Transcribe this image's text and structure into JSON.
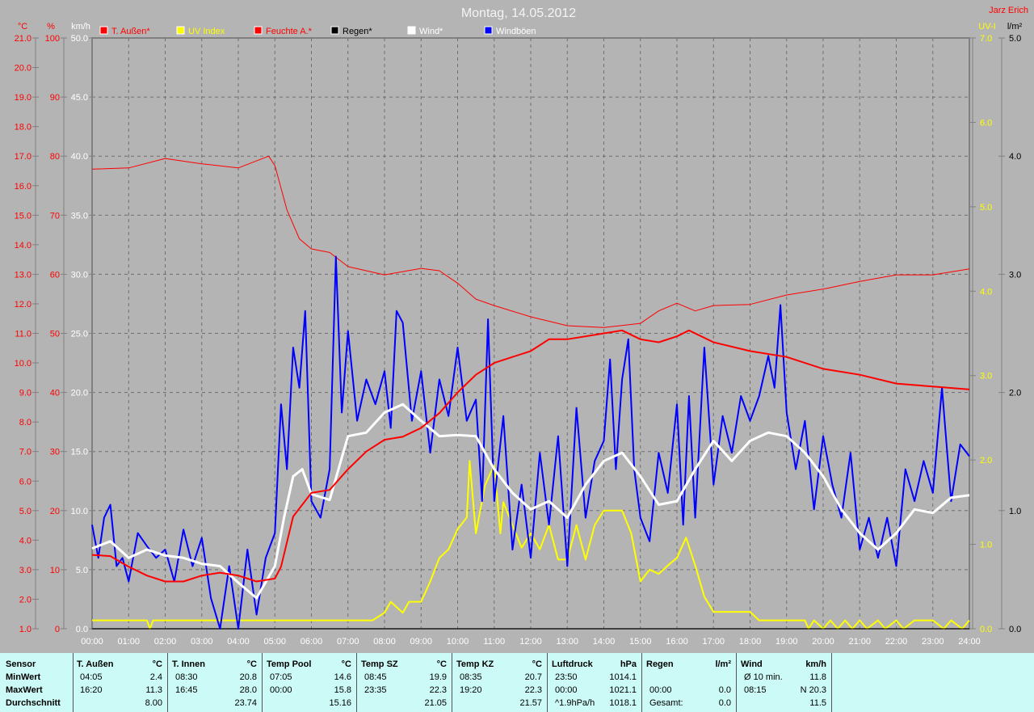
{
  "title": "Montag, 14.05.2012",
  "author": "Jarz Erich",
  "colors": {
    "temp": "#ff0000",
    "hum": "#ff0000",
    "uv": "#ffff00",
    "rain": "#000000",
    "wind": "#ffffff",
    "gust": "#0000ff"
  },
  "chart_data": {
    "type": "line",
    "title": "Montag, 14.05.2012",
    "x_unit": "hours",
    "xlim": [
      0,
      24
    ],
    "x_ticks": [
      "00:00",
      "01:00",
      "02:00",
      "03:00",
      "04:00",
      "05:00",
      "06:00",
      "07:00",
      "08:00",
      "09:00",
      "10:00",
      "11:00",
      "12:00",
      "13:00",
      "14:00",
      "15:00",
      "16:00",
      "17:00",
      "18:00",
      "19:00",
      "20:00",
      "21:00",
      "22:00",
      "23:00",
      "24:00"
    ],
    "axes": [
      {
        "id": "temp",
        "label": "°C",
        "range": [
          1,
          21
        ],
        "step": 1,
        "side": "left",
        "color": "#ff0000",
        "decimals": 1
      },
      {
        "id": "hum",
        "label": "%",
        "range": [
          0,
          100
        ],
        "step": 10,
        "side": "left",
        "color": "#ff0000",
        "decimals": 0
      },
      {
        "id": "kmh",
        "label": "km/h",
        "range": [
          0,
          50
        ],
        "step": 5,
        "side": "left",
        "color": "#ffffff",
        "decimals": 1
      },
      {
        "id": "uv",
        "label": "UV-I",
        "range": [
          0,
          7
        ],
        "step": 1,
        "side": "right",
        "color": "#ffff00",
        "decimals": 1
      },
      {
        "id": "rain",
        "label": "l/m²",
        "range": [
          0,
          5
        ],
        "step": 1,
        "side": "right",
        "color": "#000000",
        "decimals": 1
      }
    ],
    "legend": [
      "T. Außen*",
      "UV Index",
      "Feuchte A.*",
      "Regen*",
      "Wind*",
      "Windböen"
    ],
    "grid": true,
    "series": [
      {
        "name": "Feuchte A.*",
        "axis": "hum",
        "color": "#ff0000",
        "width": 1,
        "x": [
          0,
          1,
          2,
          3,
          4,
          4.83,
          5,
          5.33,
          5.67,
          6,
          6.5,
          7,
          8,
          9,
          9.5,
          10,
          10.5,
          11,
          12,
          13,
          14,
          15,
          15.5,
          16,
          16.5,
          17,
          18,
          19,
          20,
          21,
          22,
          23,
          24
        ],
        "y": [
          77.8,
          78,
          79.6,
          78.7,
          78,
          80,
          78.4,
          70.9,
          66,
          64.3,
          63.7,
          61.3,
          59.9,
          61,
          60.6,
          58.5,
          55.8,
          54.7,
          52.8,
          51.3,
          51,
          51.7,
          53.8,
          55.1,
          53.8,
          54.7,
          54.9,
          56.5,
          57.5,
          58.8,
          59.9,
          59.9,
          60.9
        ]
      },
      {
        "name": "UV Index",
        "axis": "uv",
        "color": "#ffff00",
        "width": 2,
        "x": [
          0,
          1.5,
          1.58,
          1.67,
          7.67,
          8,
          8.17,
          8.5,
          8.67,
          9,
          9.25,
          9.5,
          9.75,
          10,
          10.25,
          10.33,
          10.5,
          10.75,
          11,
          11.17,
          11.25,
          11.5,
          11.75,
          12,
          12.25,
          12.5,
          12.75,
          13,
          13.25,
          13.5,
          13.75,
          14,
          14.5,
          14.75,
          15,
          15.25,
          15.5,
          15.75,
          16,
          16.25,
          16.5,
          16.75,
          17,
          17.5,
          18,
          18.25,
          19.5,
          19.6,
          19.75,
          20,
          20.2,
          20.4,
          20.6,
          20.8,
          21,
          21.2,
          21.5,
          21.7,
          22,
          22.2,
          22.5,
          22.7,
          23,
          23.3,
          23.5,
          23.8,
          24
        ],
        "y": [
          0.1,
          0.1,
          0,
          0.1,
          0.1,
          0.19,
          0.32,
          0.19,
          0.32,
          0.32,
          0.56,
          0.84,
          0.94,
          1.18,
          1.32,
          1.99,
          1.13,
          1.7,
          1.94,
          1.13,
          1.5,
          1.23,
          0.96,
          1.13,
          0.94,
          1.23,
          0.82,
          0.82,
          1.23,
          0.82,
          1.23,
          1.4,
          1.4,
          1.13,
          0.56,
          0.7,
          0.65,
          0.75,
          0.84,
          1.08,
          0.75,
          0.38,
          0.2,
          0.2,
          0.2,
          0.1,
          0.1,
          0,
          0.1,
          0,
          0.1,
          0,
          0.1,
          0,
          0.1,
          0,
          0.1,
          0,
          0.1,
          0,
          0.1,
          0.1,
          0.1,
          0,
          0.1,
          0,
          0.1
        ]
      },
      {
        "name": "Regen*",
        "axis": "rain",
        "color": "#000000",
        "width": 1,
        "x": [
          0,
          24
        ],
        "y": [
          0,
          0
        ]
      },
      {
        "name": "Windböen",
        "axis": "kmh",
        "color": "#0000ff",
        "width": 2,
        "x": [
          0,
          0.17,
          0.33,
          0.5,
          0.67,
          0.83,
          1,
          1.25,
          1.5,
          1.75,
          2,
          2.25,
          2.5,
          2.75,
          3,
          3.25,
          3.5,
          3.75,
          4,
          4.25,
          4.5,
          4.75,
          5,
          5.17,
          5.33,
          5.5,
          5.67,
          5.83,
          6,
          6.25,
          6.5,
          6.67,
          6.83,
          7,
          7.25,
          7.5,
          7.75,
          8,
          8.17,
          8.33,
          8.5,
          8.75,
          9,
          9.25,
          9.5,
          9.75,
          10,
          10.25,
          10.5,
          10.67,
          10.83,
          11,
          11.25,
          11.5,
          11.75,
          12,
          12.25,
          12.5,
          12.75,
          13,
          13.25,
          13.5,
          13.75,
          14,
          14.17,
          14.33,
          14.5,
          14.67,
          14.83,
          15,
          15.25,
          15.5,
          15.75,
          16,
          16.17,
          16.33,
          16.5,
          16.75,
          17,
          17.25,
          17.5,
          17.75,
          18,
          18.25,
          18.5,
          18.67,
          18.83,
          19,
          19.25,
          19.5,
          19.75,
          20,
          20.25,
          20.5,
          20.75,
          21,
          21.25,
          21.5,
          21.75,
          22,
          22.25,
          22.5,
          22.75,
          23,
          23.25,
          23.5,
          23.75,
          24
        ],
        "y": [
          8.8,
          6,
          9.4,
          10.5,
          5.3,
          6,
          4,
          8.1,
          7,
          6,
          6.7,
          4,
          8.4,
          5.3,
          7.7,
          2.6,
          0,
          5.3,
          0,
          6.7,
          1.2,
          6,
          8.1,
          19,
          13.5,
          23.8,
          20.4,
          26.9,
          10.8,
          9.4,
          13.5,
          31.5,
          18.3,
          25.2,
          17.6,
          21.1,
          19,
          21.8,
          17,
          26.9,
          25.9,
          17.6,
          21.8,
          14.9,
          21.1,
          18,
          23.8,
          17.6,
          19.4,
          10.8,
          26.2,
          10.8,
          18,
          6.7,
          12.2,
          6,
          14.9,
          8.8,
          16.3,
          5.3,
          18.7,
          9.4,
          14.2,
          15.9,
          22.8,
          13.5,
          21.1,
          24.5,
          13.5,
          9.4,
          7.4,
          14.9,
          11.5,
          19,
          8.8,
          19.7,
          9.4,
          23.8,
          12.2,
          18,
          14.9,
          19.7,
          17.6,
          19.7,
          23.1,
          20.4,
          27.4,
          18.3,
          13.5,
          17.6,
          10.1,
          16.3,
          12.2,
          9.4,
          14.9,
          6.7,
          9.4,
          6,
          9.4,
          5.3,
          13.5,
          10.8,
          14.2,
          11.5,
          20.4,
          10.8,
          15.6,
          14.6
        ]
      },
      {
        "name": "Wind*",
        "axis": "kmh",
        "color": "#ffffff",
        "width": 3,
        "x": [
          0,
          0.5,
          1,
          1.5,
          2,
          2.5,
          3,
          3.5,
          4,
          4.5,
          5,
          5.25,
          5.5,
          5.75,
          6,
          6.5,
          7,
          7.5,
          8,
          8.5,
          9,
          9.5,
          10,
          10.5,
          11,
          11.5,
          12,
          12.5,
          13,
          13.5,
          14,
          14.5,
          15,
          15.5,
          16,
          16.5,
          17,
          17.5,
          18,
          18.5,
          19,
          19.5,
          20,
          20.5,
          21,
          21.5,
          22,
          22.5,
          23,
          23.5,
          24
        ],
        "y": [
          6.8,
          7.4,
          6,
          6.7,
          6.2,
          6,
          5.5,
          5.3,
          3.9,
          2.6,
          5.3,
          9.4,
          12.9,
          13.5,
          11.4,
          10.9,
          16.3,
          16.6,
          18.3,
          19,
          17.6,
          16.3,
          16.4,
          16.3,
          13.5,
          11.5,
          10.1,
          10.8,
          9.4,
          12.2,
          14.2,
          14.9,
          12.9,
          10.5,
          10.8,
          13.5,
          15.9,
          14.2,
          15.9,
          16.6,
          16.3,
          14.9,
          12.9,
          10.1,
          8.1,
          6.7,
          8.1,
          10.1,
          9.8,
          11.1,
          11.3
        ]
      },
      {
        "name": "T. Außen*",
        "axis": "temp",
        "color": "#ff0000",
        "width": 2,
        "x": [
          0,
          0.5,
          1,
          1.5,
          2,
          2.5,
          3,
          3.5,
          4,
          4.5,
          5,
          5.17,
          5.5,
          6,
          6.5,
          7,
          7.5,
          8,
          8.5,
          9,
          9.5,
          10,
          10.5,
          11,
          11.5,
          12,
          12.5,
          13,
          14,
          14.5,
          15,
          15.5,
          16,
          16.33,
          17,
          18,
          19,
          20,
          21,
          22,
          23,
          24
        ],
        "y": [
          3.5,
          3.46,
          3.1,
          2.8,
          2.6,
          2.6,
          2.8,
          2.9,
          2.8,
          2.6,
          2.7,
          3.1,
          4.8,
          5.6,
          5.7,
          6.4,
          7,
          7.4,
          7.5,
          7.8,
          8.3,
          9,
          9.6,
          10,
          10.2,
          10.4,
          10.8,
          10.8,
          11,
          11.1,
          10.8,
          10.7,
          10.9,
          11.1,
          10.7,
          10.4,
          10.2,
          9.8,
          9.6,
          9.3,
          9.2,
          9.1
        ]
      }
    ]
  },
  "stats": {
    "row_labels": [
      "Sensor",
      "MinWert",
      "MaxWert",
      "Durchschnitt"
    ],
    "columns": [
      {
        "name": "T. Außen",
        "unit": "°C",
        "rows": [
          [
            "04:05",
            "2.4"
          ],
          [
            "16:20",
            "11.3"
          ],
          [
            "",
            "8.00"
          ]
        ]
      },
      {
        "name": "T. Innen",
        "unit": "°C",
        "rows": [
          [
            "08:30",
            "20.8"
          ],
          [
            "16:45",
            "28.0"
          ],
          [
            "",
            "23.74"
          ]
        ]
      },
      {
        "name": "Temp Pool",
        "unit": "°C",
        "rows": [
          [
            "07:05",
            "14.6"
          ],
          [
            "00:00",
            "15.8"
          ],
          [
            "",
            "15.16"
          ]
        ]
      },
      {
        "name": "Temp SZ",
        "unit": "°C",
        "rows": [
          [
            "08:45",
            "19.9"
          ],
          [
            "23:35",
            "22.3"
          ],
          [
            "",
            "21.05"
          ]
        ]
      },
      {
        "name": "Temp KZ",
        "unit": "°C",
        "rows": [
          [
            "08:35",
            "20.7"
          ],
          [
            "19:20",
            "22.3"
          ],
          [
            "",
            "21.57"
          ]
        ]
      },
      {
        "name": "Luftdruck",
        "unit": "hPa",
        "rows": [
          [
            "23:50",
            "1014.1"
          ],
          [
            "00:00",
            "1021.1"
          ],
          [
            "^1.9hPa/h",
            "1018.1"
          ]
        ]
      },
      {
        "name": "Regen",
        "unit": "l/m²",
        "rows": [
          [
            "",
            ""
          ],
          [
            "00:00",
            "0.0"
          ],
          [
            "Gesamt:",
            "0.0"
          ]
        ]
      },
      {
        "name": "Wind",
        "unit": "km/h",
        "rows": [
          [
            "Ø 10 min.",
            "11.8"
          ],
          [
            "08:15",
            "N 20.3"
          ],
          [
            "",
            "11.5"
          ]
        ]
      }
    ]
  }
}
